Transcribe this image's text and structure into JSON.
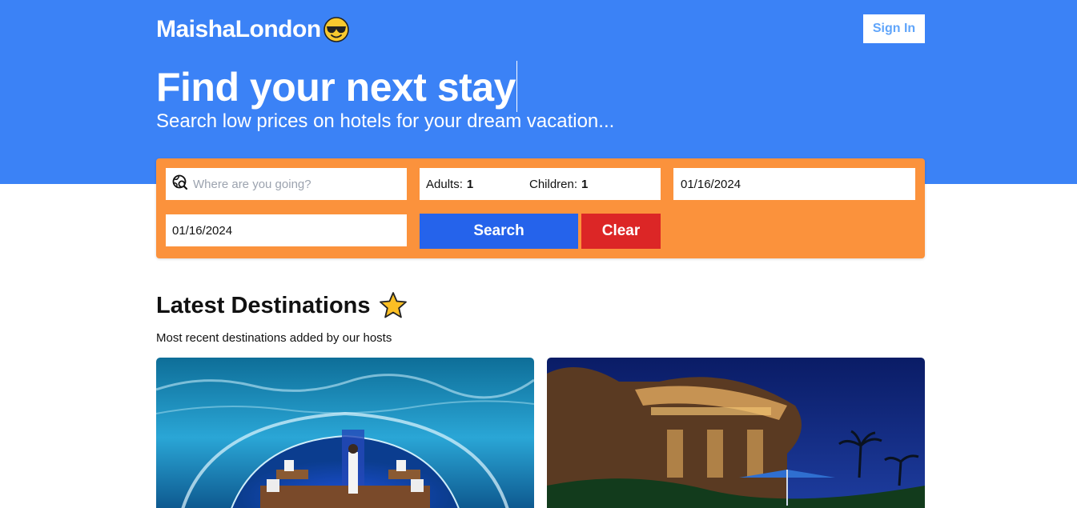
{
  "header": {
    "brand": "MaishaLondon",
    "brand_icon": "sunglasses-emoji-icon",
    "sign_in_label": "Sign In"
  },
  "hero": {
    "title": "Find your next stay",
    "subtitle": "Search low prices on hotels for your dream vacation..."
  },
  "search": {
    "destination_placeholder": "Where are you going?",
    "destination_value": "",
    "destination_icon": "globe-search-icon",
    "adults_label": "Adults:",
    "adults_value": "1",
    "children_label": "Children:",
    "children_value": "1",
    "check_in": "01/16/2024",
    "check_out": "01/16/2024",
    "search_label": "Search",
    "clear_label": "Clear"
  },
  "destinations": {
    "title": "Latest Destinations",
    "title_icon": "star-icon",
    "subtitle": "Most recent destinations added by our hosts",
    "cards": [
      {
        "image": "underwater-restaurant-photo"
      },
      {
        "image": "night-resort-photo"
      }
    ]
  },
  "colors": {
    "hero_bg": "#3b82f6",
    "panel_bg": "#fb923c",
    "search_btn": "#2563eb",
    "clear_btn": "#dc2626",
    "sign_in_text": "#60a5fa"
  }
}
